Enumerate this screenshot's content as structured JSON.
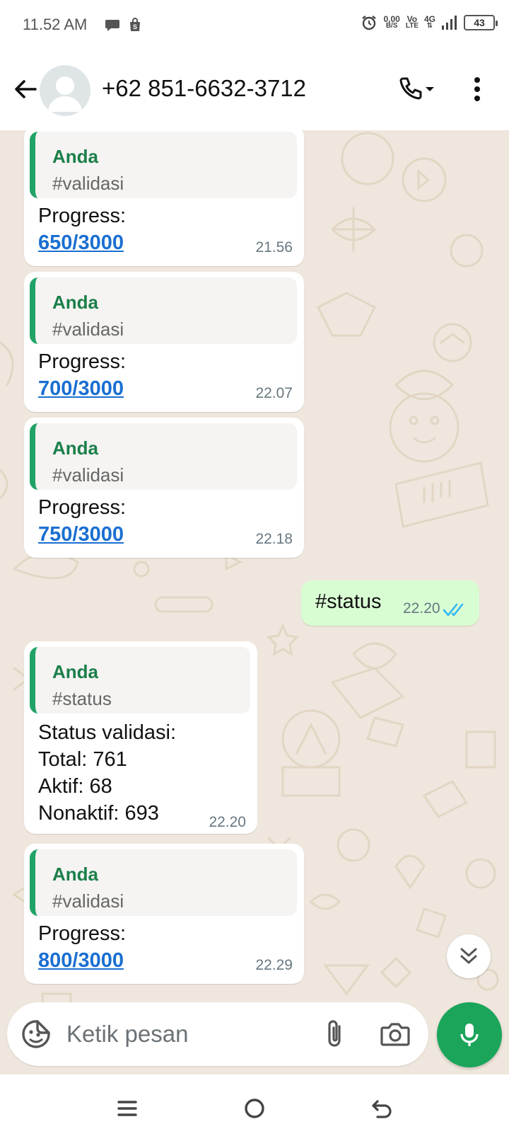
{
  "status_bar": {
    "time": "11.52 AM",
    "net_speed_value": "0,00",
    "net_speed_unit": "B/S",
    "volte_top": "Vo",
    "volte_bottom": "LTE",
    "network_type": "4G",
    "battery": "43"
  },
  "header": {
    "contact": "+62 851-6632-3712"
  },
  "messages": [
    {
      "quote_author": "Anda",
      "quote_text": "#validasi",
      "label": "Progress:",
      "value": "650/3000",
      "time": "21.56"
    },
    {
      "quote_author": "Anda",
      "quote_text": "#validasi",
      "label": "Progress:",
      "value": "700/3000",
      "time": "22.07"
    },
    {
      "quote_author": "Anda",
      "quote_text": "#validasi",
      "label": "Progress:",
      "value": "750/3000",
      "time": "22.18"
    },
    {
      "text": "#status",
      "time": "22.20"
    },
    {
      "quote_author": "Anda",
      "quote_text": "#status",
      "lines": [
        "Status validasi:",
        "Total: 761",
        "Aktif: 68",
        "Nonaktif: 693"
      ],
      "time": "22.20"
    },
    {
      "quote_author": "Anda",
      "quote_text": "#validasi",
      "label": "Progress:",
      "value": "800/3000",
      "time": "22.29"
    }
  ],
  "composer": {
    "placeholder": "Ketik pesan"
  },
  "colors": {
    "accent": "#1aa55b",
    "outgoing_bubble": "#d9fdd3",
    "chat_background": "#efe7dd",
    "link": "#1a6fd1",
    "read_ticks": "#34b7f1"
  }
}
